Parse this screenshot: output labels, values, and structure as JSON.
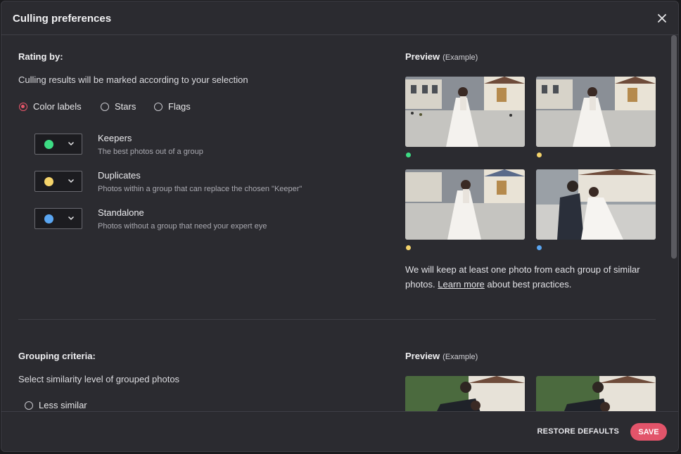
{
  "dialog": {
    "title": "Culling preferences",
    "close_icon": "close-icon"
  },
  "rating": {
    "heading": "Rating by:",
    "description": "Culling results will be marked according to your selection",
    "options": [
      {
        "label": "Color labels",
        "selected": true
      },
      {
        "label": "Stars",
        "selected": false
      },
      {
        "label": "Flags",
        "selected": false
      }
    ],
    "labels": [
      {
        "title": "Keepers",
        "desc": "The best photos out of a group",
        "color": "#3ddc84"
      },
      {
        "title": "Duplicates",
        "desc": "Photos within a group that can replace the chosen \"Keeper\"",
        "color": "#f5d46b"
      },
      {
        "title": "Standalone",
        "desc": "Photos without a group that need your expert eye",
        "color": "#5aa6f2"
      }
    ]
  },
  "preview1": {
    "heading": "Preview",
    "example": "(Example)",
    "photo_dots": [
      "#3ddc84",
      "#f5d46b",
      "#f5d46b",
      "#5aa6f2"
    ],
    "note_before": "We will keep at least one photo from each group of similar photos.",
    "link": "Learn more",
    "note_after": "about best practices."
  },
  "grouping": {
    "heading": "Grouping criteria:",
    "description": "Select similarity level of grouped photos",
    "options": [
      {
        "label": "Less similar",
        "selected": false
      }
    ]
  },
  "preview2": {
    "heading": "Preview",
    "example": "(Example)"
  },
  "footer": {
    "restore_label": "RESTORE DEFAULTS",
    "save_label": "SAVE"
  },
  "colors": {
    "accent": "#e2546a",
    "background": "#2b2b30"
  }
}
